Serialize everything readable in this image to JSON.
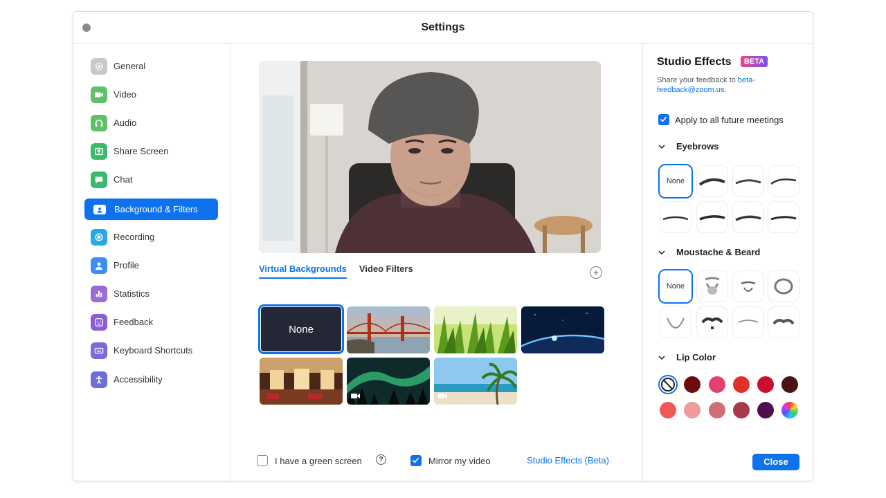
{
  "window": {
    "title": "Settings"
  },
  "sidebar": {
    "items": [
      {
        "label": "General",
        "icon": "gear-icon",
        "color": "#c8c8c8"
      },
      {
        "label": "Video",
        "icon": "video-camera-icon",
        "color": "#5cc168"
      },
      {
        "label": "Audio",
        "icon": "headphones-icon",
        "color": "#5cc168"
      },
      {
        "label": "Share Screen",
        "icon": "share-screen-icon",
        "color": "#3aba6d"
      },
      {
        "label": "Chat",
        "icon": "chat-bubble-icon",
        "color": "#3aba6d"
      },
      {
        "label": "Background & Filters",
        "icon": "background-icon",
        "color": "#0e72ed",
        "active": true
      },
      {
        "label": "Recording",
        "icon": "record-icon",
        "color": "#27a9e8"
      },
      {
        "label": "Profile",
        "icon": "person-icon",
        "color": "#3c8ef5"
      },
      {
        "label": "Statistics",
        "icon": "bar-chart-icon",
        "color": "#9b6bd6"
      },
      {
        "label": "Feedback",
        "icon": "smiley-icon",
        "color": "#8b5cd6"
      },
      {
        "label": "Keyboard Shortcuts",
        "icon": "keyboard-icon",
        "color": "#7d6ad8"
      },
      {
        "label": "Accessibility",
        "icon": "accessibility-icon",
        "color": "#6c6fd8"
      }
    ]
  },
  "center": {
    "tabs": [
      {
        "label": "Virtual Backgrounds",
        "active": true
      },
      {
        "label": "Video Filters",
        "active": false
      }
    ],
    "none_label": "None",
    "green_screen_label": "I have a green screen",
    "green_screen_checked": false,
    "mirror_label": "Mirror my video",
    "mirror_checked": true,
    "studio_effects_link": "Studio Effects (Beta)"
  },
  "studio": {
    "title": "Studio Effects",
    "badge": "BETA",
    "feedback_text": "Share your feedback to ",
    "feedback_email": "beta-feedback@zoom.us",
    "feedback_suffix": ".",
    "apply_label": "Apply to all future meetings",
    "apply_checked": true,
    "eyebrows_label": "Eyebrows",
    "beard_label": "Moustache & Beard",
    "lip_label": "Lip Color",
    "none_label": "None",
    "lip_colors": [
      "#6b0d0d",
      "#e0416e",
      "#e0302a",
      "#c8102e",
      "#4a1414",
      "#f05858",
      "#f19a9e",
      "#cf6f74",
      "#a8384a",
      "#4d0f4d"
    ],
    "close_label": "Close"
  }
}
